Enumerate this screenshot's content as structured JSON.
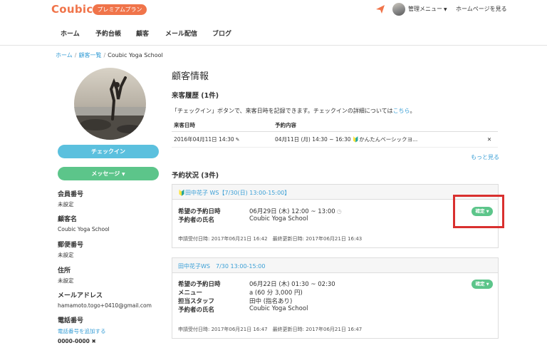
{
  "header": {
    "logo": "Coubic",
    "premium_badge": "プレミアムプラン",
    "admin_menu": "管理メニュー",
    "homepage_link": "ホームページを見る"
  },
  "nav": {
    "items": [
      {
        "label": "ホーム"
      },
      {
        "label": "予約台帳"
      },
      {
        "label": "顧客"
      },
      {
        "label": "メール配信"
      },
      {
        "label": "ブログ"
      }
    ]
  },
  "breadcrumb": {
    "home": "ホーム",
    "customers": "顧客一覧",
    "current": "Coubic Yoga School"
  },
  "sidebar": {
    "checkin_button": "チェックイン",
    "message_button": "メッセージ",
    "fields": {
      "member_no": {
        "label": "会員番号",
        "value": "未設定"
      },
      "customer_name": {
        "label": "顧客名",
        "value": "Coubic Yoga School"
      },
      "postal_code": {
        "label": "郵便番号",
        "value": "未設定"
      },
      "address": {
        "label": "住所",
        "value": "未設定"
      },
      "email": {
        "label": "メールアドレス",
        "value": "hamamoto.togo+0410@gmail.com"
      },
      "phone": {
        "label": "電話番号",
        "add_link": "電話番号を追加する",
        "value": "0000-0000"
      }
    }
  },
  "main": {
    "title": "顧客情報",
    "visit_history": {
      "title": "来客履歴 (1件)",
      "desc_prefix": "「チェックイン」ボタンで、来客日時を記録できます。チェックインの詳細については",
      "desc_link": "こちら",
      "desc_suffix": "。",
      "columns": [
        "来客日時",
        "予約内容"
      ],
      "rows": [
        {
          "date": "2016年04月11日 14:30",
          "content": "04月11日 (月) 14:30 ~ 16:30 🔰かんたんベーシックヨ..."
        }
      ],
      "more_link": "もっと見る"
    },
    "reservations": {
      "title": "予約状況 (3件)",
      "items": [
        {
          "header": "田中花子 WS【7/30(日) 13:00-15:00】",
          "status": "確定",
          "fields": [
            {
              "k": "希望の予約日時",
              "v": "06月29日 (木) 12:00 ~ 13:00"
            },
            {
              "k": "予約者の氏名",
              "v": "Coubic Yoga School"
            }
          ],
          "meta": "申請受付日時: 2017年06月21日 16:42　最終更新日時: 2017年06月21日 16:43"
        },
        {
          "header": "田中花子WS　7/30 13:00-15:00",
          "status": "確定",
          "fields": [
            {
              "k": "希望の予約日時",
              "v": "06月22日 (木) 01:30 ~ 02:30"
            },
            {
              "k": "メニュー",
              "v": "a (60 分 3,000 円)"
            },
            {
              "k": "担当スタッフ",
              "v": "田中 (指名あり)"
            },
            {
              "k": "予約者の氏名",
              "v": "Coubic Yoga School"
            }
          ],
          "meta": "申請受付日時: 2017年06月21日 16:47　最終更新日時: 2017年06月21日 16:47"
        }
      ]
    }
  },
  "colors": {
    "brand": "#f0744a",
    "link": "#3a9fd6",
    "checkin": "#5bc0de",
    "success": "#5cc58a",
    "highlight_box": "#d9302f"
  },
  "icons": [
    "paper-plane-icon",
    "pencil-icon",
    "clock-icon",
    "beginner-leaf-icon",
    "caret-down-icon",
    "close-icon"
  ]
}
